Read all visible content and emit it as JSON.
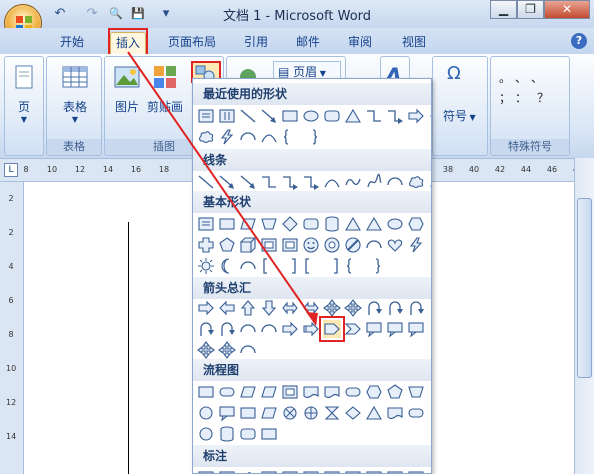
{
  "window": {
    "title": "文档 1 - Microsoft Word"
  },
  "quick_access": {
    "undo": "↶",
    "redo": "↷",
    "print_preview": "🔍",
    "save": "💾",
    "customize": "▾"
  },
  "tabs": [
    {
      "label": "开始"
    },
    {
      "label": "插入"
    },
    {
      "label": "页面布局"
    },
    {
      "label": "引用"
    },
    {
      "label": "邮件"
    },
    {
      "label": "审阅"
    },
    {
      "label": "视图"
    }
  ],
  "ribbon": {
    "pages_label": "页",
    "table_label": "表格",
    "table_group": "表格",
    "picture_label": "图片",
    "clipart_label": "剪贴画",
    "illustrations_group": "插图",
    "header_label": "页眉",
    "symbol_label": "符号",
    "special_symbols_group": "特殊符号",
    "special_symbols": [
      [
        "。",
        "、",
        "、"
      ],
      [
        "；",
        "：",
        "？"
      ]
    ]
  },
  "ruler": {
    "numbers": [
      "8",
      "10",
      "12",
      "14",
      "16",
      "18",
      "38",
      "40",
      "42",
      "44",
      "46",
      "48"
    ]
  },
  "vruler": {
    "numbers": [
      "2",
      "2",
      "4",
      "6",
      "8",
      "10",
      "12",
      "14"
    ]
  },
  "shapes_panel": {
    "sections": [
      {
        "title": "最近使用的形状"
      },
      {
        "title": "线条"
      },
      {
        "title": "基本形状"
      },
      {
        "title": "箭头总汇"
      },
      {
        "title": "流程图"
      },
      {
        "title": "标注"
      }
    ]
  },
  "colors": {
    "highlight": "#e02424",
    "accent": "#15428b"
  }
}
